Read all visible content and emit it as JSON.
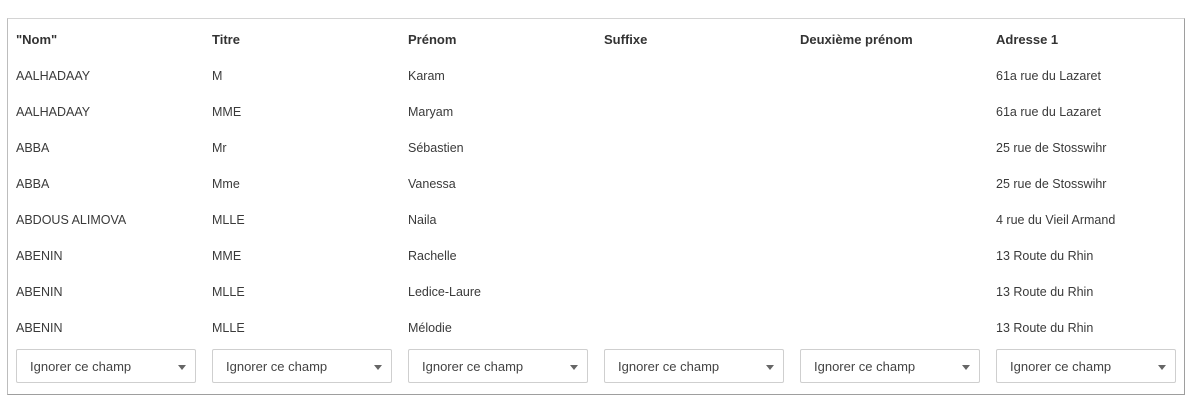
{
  "columns": [
    "\"Nom\"",
    "Titre",
    "Prénom",
    "Suffixe",
    "Deuxième prénom",
    "Adresse 1"
  ],
  "rows": [
    [
      "AALHADAAY",
      "M",
      "Karam",
      "",
      "",
      "61a rue du Lazaret"
    ],
    [
      "AALHADAAY",
      "MME",
      "Maryam",
      "",
      "",
      "61a rue du Lazaret"
    ],
    [
      "ABBA",
      "Mr",
      "Sébastien",
      "",
      "",
      "25 rue de Stosswihr"
    ],
    [
      "ABBA",
      "Mme",
      "Vanessa",
      "",
      "",
      "25 rue de Stosswihr"
    ],
    [
      "ABDOUS ALIMOVA",
      "MLLE",
      "Naila",
      "",
      "",
      "4 rue du Vieil Armand"
    ],
    [
      "ABENIN",
      "MME",
      "Rachelle",
      "",
      "",
      "13 Route du Rhin"
    ],
    [
      "ABENIN",
      "MLLE",
      "Ledice-Laure",
      "",
      "",
      "13 Route du Rhin"
    ],
    [
      "ABENIN",
      "MLLE",
      "Mélodie",
      "",
      "",
      "13 Route du Rhin"
    ]
  ],
  "field_mappings": [
    {
      "selected": "Ignorer ce champ"
    },
    {
      "selected": "Ignorer ce champ"
    },
    {
      "selected": "Ignorer ce champ"
    },
    {
      "selected": "Ignorer ce champ"
    },
    {
      "selected": "Ignorer ce champ"
    },
    {
      "selected": "Ignorer ce champ"
    }
  ],
  "icons": {
    "dropdown": "chevron-down-icon"
  }
}
